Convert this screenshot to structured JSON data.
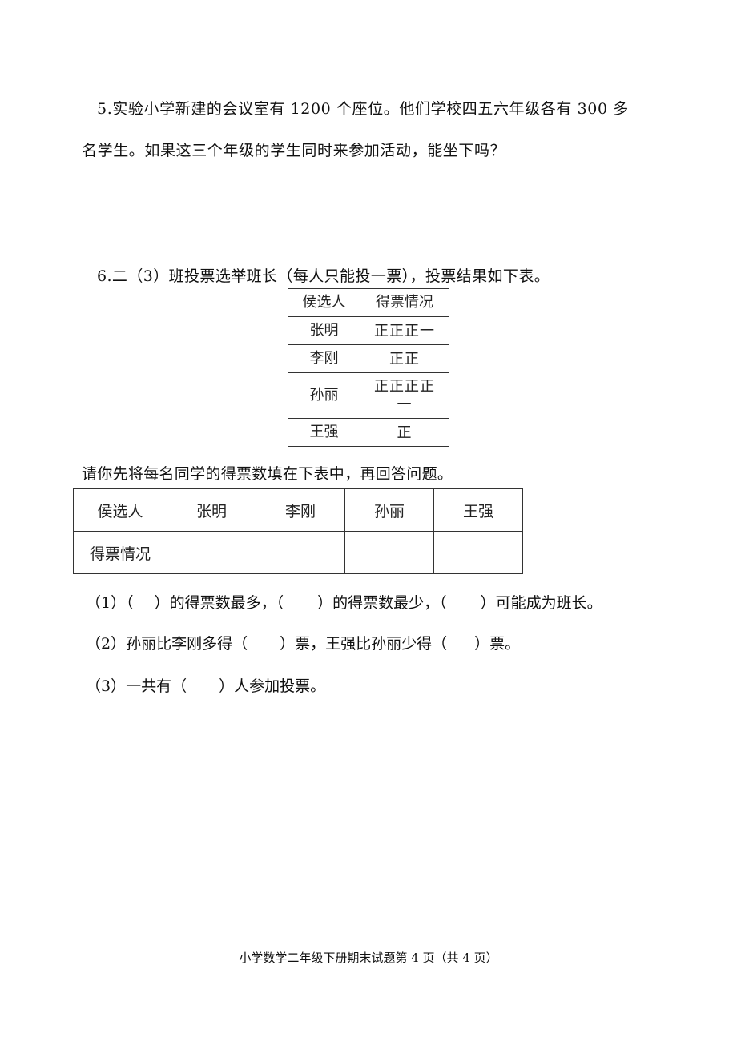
{
  "question5": {
    "line1": "5.实验小学新建的会议室有 1200 个座位。他们学校四五六年级各有 300 多",
    "line2": "名学生。如果这三个年级的学生同时来参加活动，能坐下吗？"
  },
  "question6": {
    "intro": "6.二（3）班投票选举班长（每人只能投一票），投票结果如下表。",
    "tally_table": {
      "headers": [
        "侯选人",
        "得票情况"
      ],
      "rows": [
        {
          "name": "张明",
          "marks": "正正正一"
        },
        {
          "name": "李刚",
          "marks": "正正"
        },
        {
          "name": "孙丽",
          "marks": "正正正正一"
        },
        {
          "name": "王强",
          "marks": "正"
        }
      ]
    },
    "instruction": "请你先将每名同学的得票数填在下表中，再回答问题。",
    "fill_table": {
      "row_header_1": "侯选人",
      "row_header_2": "得票情况",
      "candidates": [
        "张明",
        "李刚",
        "孙丽",
        "王强"
      ],
      "votes": [
        "",
        "",
        "",
        ""
      ]
    },
    "sub_questions": [
      {
        "parts": [
          "（1）（",
          "）的得票数最多，（",
          "）的得票数最少，（",
          "）可能成为班长。"
        ]
      },
      {
        "parts": [
          "（2）孙丽比李刚多得（",
          "）票，王强比孙丽少得（",
          "）票。"
        ]
      },
      {
        "parts": [
          "（3）一共有（",
          "）人参加投票。"
        ]
      }
    ]
  },
  "footer": "小学数学二年级下册期末试题第 4 页（共 4 页）"
}
